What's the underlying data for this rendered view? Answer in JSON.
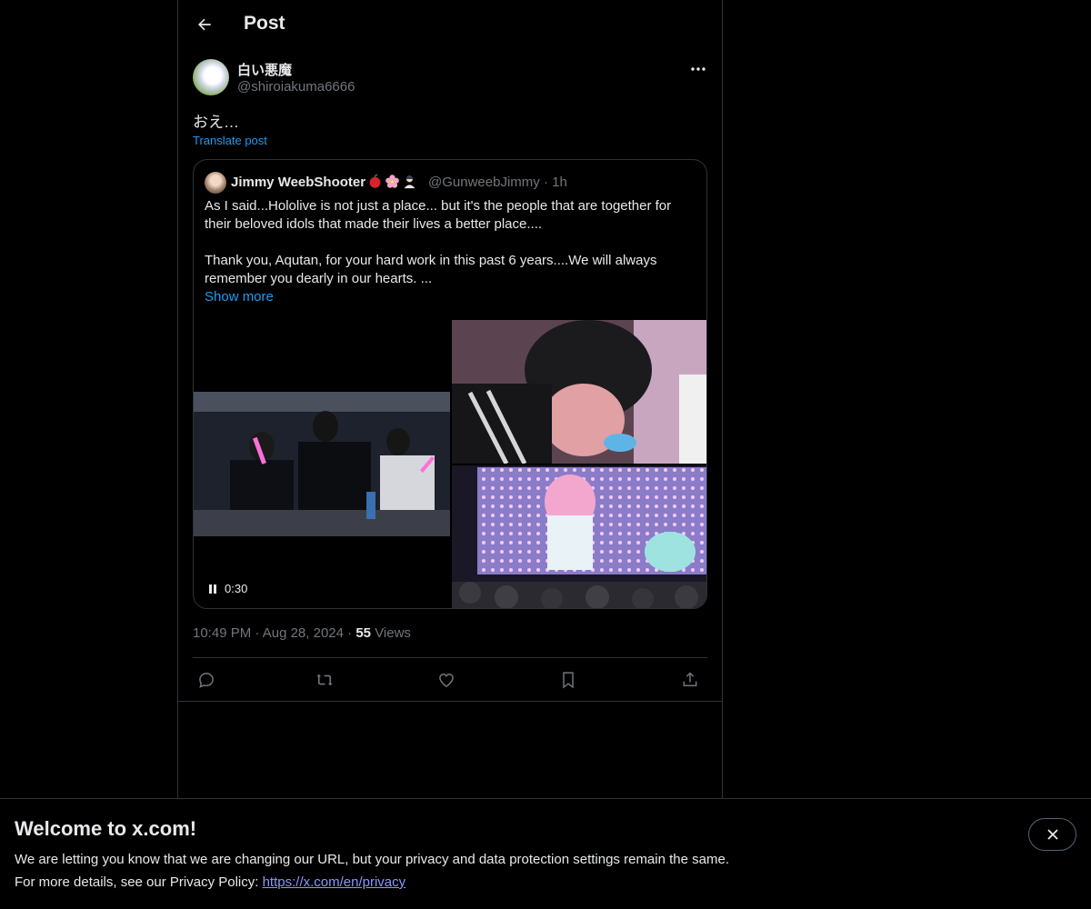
{
  "header": {
    "title": "Post"
  },
  "post": {
    "author_name": "白い悪魔",
    "author_handle": "@shiroiakuma6666",
    "text": "おえ…",
    "translate_label": "Translate post",
    "time": "10:49 PM",
    "date": "Aug 28, 2024",
    "views_count": "55",
    "views_label": "Views",
    "separator": "·"
  },
  "quote": {
    "author_name": "Jimmy WeebShooter",
    "emoji_icons": [
      "apple-icon",
      "cherry-blossom-icon",
      "person-icon"
    ],
    "author_handle": "@GunweebJimmy",
    "age": "1h",
    "text": "As I said...Hololive is not just a place... but it's the people that are together for their beloved idols that made their lives a better place....\n\nThank you, Aqutan, for your hard work in this past 6 years....We will always remember you dearly in our hearts. ...",
    "show_more": "Show more",
    "video_time": "0:30"
  },
  "actions": [
    "reply-icon",
    "repost-icon",
    "like-icon",
    "bookmark-icon",
    "share-icon"
  ],
  "banner": {
    "title": "Welcome to x.com!",
    "line1": "We are letting you know that we are changing our URL, but your privacy and data protection settings remain the same.",
    "line2_prefix": "For more details, see our Privacy Policy: ",
    "link": "https://x.com/en/privacy"
  },
  "colors": {
    "background": "#000000",
    "text": "#e7e9ea",
    "muted": "#71767b",
    "accent": "#1d9bf0",
    "border": "#2f3336",
    "link_banner": "#8b98f9"
  }
}
